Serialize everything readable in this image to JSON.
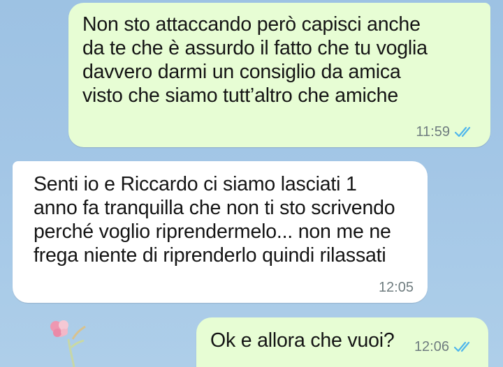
{
  "messages": [
    {
      "direction": "outgoing",
      "text": "Non sto attaccando però capisci anche\nda te che è assurdo il fatto che tu voglia\ndavvero darmi un consiglio da amica\nvisto che siamo tutt’altro che amiche",
      "time": "11:59",
      "status_icon": "double-check-read-icon"
    },
    {
      "direction": "incoming",
      "text": "Senti io e Riccardo ci siamo lasciati 1\nanno fa tranquilla che non ti sto scrivendo\nperché voglio riprendermelo... non me ne\nfrega niente di riprenderlo quindi rilassati",
      "time": "12:05"
    },
    {
      "direction": "outgoing",
      "text": "Ok e allora che vuoi?",
      "time": "12:06",
      "status_icon": "double-check-read-icon"
    }
  ],
  "colors": {
    "outgoing_bubble": "#e7fdd4",
    "incoming_bubble": "#ffffff",
    "read_ticks": "#4fb6ec",
    "timestamp": "#6f7c7f",
    "wallpaper": "#a3c6e6"
  },
  "wallpaper_icon": "flower-icon"
}
